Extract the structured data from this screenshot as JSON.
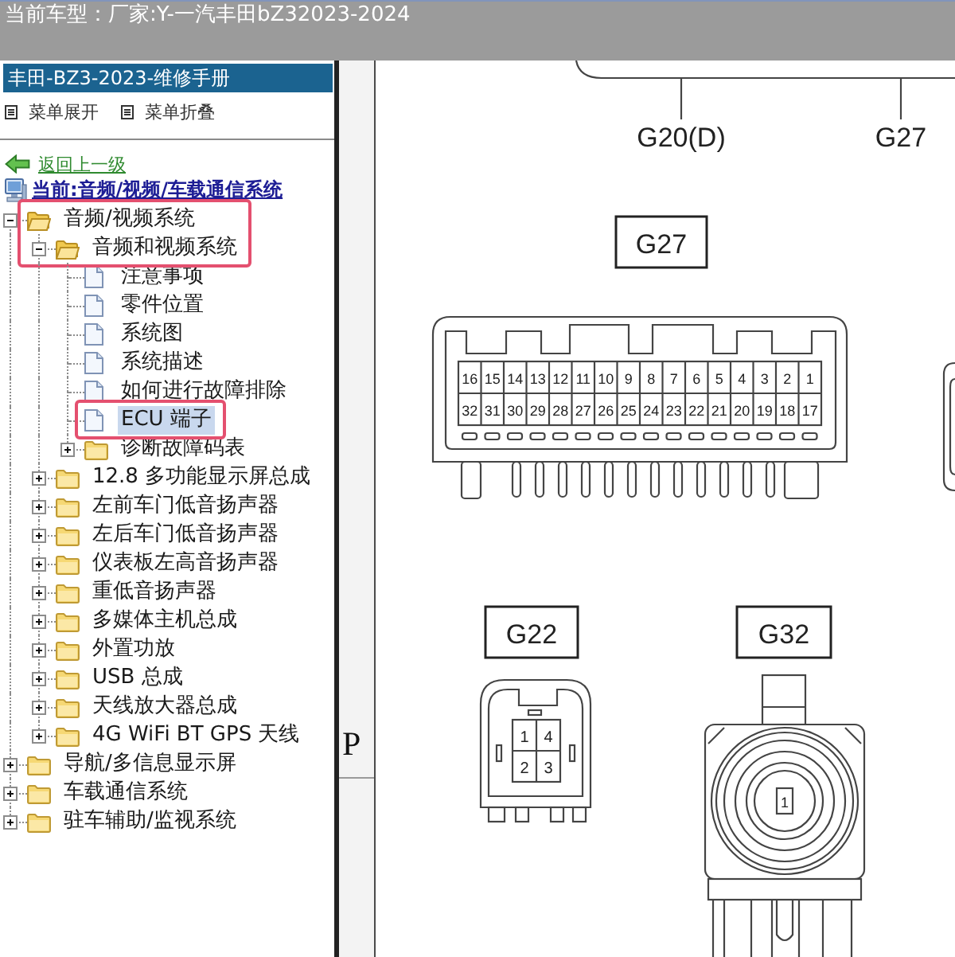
{
  "header": {
    "label": "当前车型：",
    "value": "厂家:Y-一汽丰田bZ32023-2024"
  },
  "sidebar": {
    "title": "丰田-BZ3-2023-维修手册",
    "menu_actions": [
      "菜单展开",
      "菜单折叠"
    ],
    "back_link": "返回上一级",
    "breadcrumb": "当前:音频/视频/车载通信系统",
    "tree": [
      {
        "label": "音频/视频系统",
        "kind": "folder",
        "expanded": true,
        "selected": false,
        "marked": true,
        "children": [
          {
            "label": "音频和视频系统",
            "kind": "folder",
            "expanded": true,
            "selected": false,
            "marked": true,
            "children": [
              {
                "label": "注意事项",
                "kind": "page",
                "selected": false,
                "marked": false
              },
              {
                "label": "零件位置",
                "kind": "page",
                "selected": false,
                "marked": false
              },
              {
                "label": "系统图",
                "kind": "page",
                "selected": false,
                "marked": false
              },
              {
                "label": "系统描述",
                "kind": "page",
                "selected": false,
                "marked": false
              },
              {
                "label": "如何进行故障排除",
                "kind": "page",
                "selected": false,
                "marked": false
              },
              {
                "label": "ECU 端子",
                "kind": "page",
                "selected": true,
                "marked": true
              },
              {
                "label": "诊断故障码表",
                "kind": "folder",
                "expanded": false,
                "selected": false,
                "marked": false
              }
            ]
          },
          {
            "label": "12.8 多功能显示屏总成",
            "kind": "folder",
            "expanded": false,
            "selected": false,
            "marked": false
          },
          {
            "label": "左前车门低音扬声器",
            "kind": "folder",
            "expanded": false,
            "selected": false,
            "marked": false
          },
          {
            "label": "左后车门低音扬声器",
            "kind": "folder",
            "expanded": false,
            "selected": false,
            "marked": false
          },
          {
            "label": "仪表板左高音扬声器",
            "kind": "folder",
            "expanded": false,
            "selected": false,
            "marked": false
          },
          {
            "label": "重低音扬声器",
            "kind": "folder",
            "expanded": false,
            "selected": false,
            "marked": false
          },
          {
            "label": "多媒体主机总成",
            "kind": "folder",
            "expanded": false,
            "selected": false,
            "marked": false
          },
          {
            "label": "外置功放",
            "kind": "folder",
            "expanded": false,
            "selected": false,
            "marked": false
          },
          {
            "label": "USB 总成",
            "kind": "folder",
            "expanded": false,
            "selected": false,
            "marked": false
          },
          {
            "label": "天线放大器总成",
            "kind": "folder",
            "expanded": false,
            "selected": false,
            "marked": false
          },
          {
            "label": "4G WiFi BT GPS 天线",
            "kind": "folder",
            "expanded": false,
            "selected": false,
            "marked": false
          }
        ]
      },
      {
        "label": "导航/多信息显示屏",
        "kind": "folder",
        "expanded": false,
        "selected": false,
        "marked": false
      },
      {
        "label": "车载通信系统",
        "kind": "folder",
        "expanded": false,
        "selected": false,
        "marked": false
      },
      {
        "label": "驻车辅助/监视系统",
        "kind": "folder",
        "expanded": false,
        "selected": false,
        "marked": false
      }
    ]
  },
  "side_strip": {
    "text": "P"
  },
  "diagram": {
    "callouts": [
      "G20(D)",
      "G27"
    ],
    "connectors": [
      {
        "kind": "ecu_32pin",
        "label": "G27",
        "pins": [
          [
            "16",
            "15",
            "14",
            "13",
            "12",
            "11",
            "10",
            "9",
            "8",
            "7",
            "6",
            "5",
            "4",
            "3",
            "2",
            "1"
          ],
          [
            "32",
            "31",
            "30",
            "29",
            "28",
            "27",
            "26",
            "25",
            "24",
            "23",
            "22",
            "21",
            "20",
            "19",
            "18",
            "17"
          ]
        ]
      },
      {
        "kind": "square_4pin",
        "label": "G22",
        "pins": [
          [
            "1",
            "4"
          ],
          [
            "2",
            "3"
          ]
        ]
      },
      {
        "kind": "coaxial",
        "label": "G32",
        "pins": [
          [
            "1"
          ]
        ]
      }
    ]
  }
}
